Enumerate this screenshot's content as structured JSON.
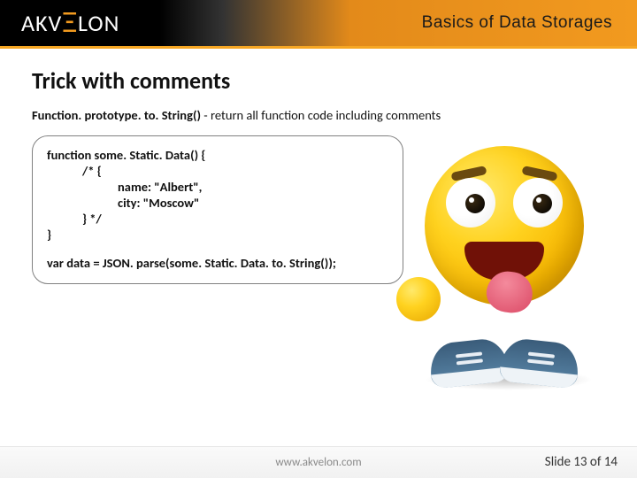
{
  "header": {
    "logo_left": "AKV",
    "logo_e": "Ξ",
    "logo_right": "LON",
    "title": "Basics of Data Storages"
  },
  "slide": {
    "title": "Trick with comments",
    "subtitle_func": "Function. prototype. to. String()",
    "subtitle_rest": "  -  return all function code including comments"
  },
  "code": {
    "l1": "function some. Static. Data() {",
    "l2": "/* {",
    "l3": "name: \"Albert\",",
    "l4": "city: \"Moscow\"",
    "l5": "} */",
    "l6": "}",
    "l7": "var data = JSON. parse(some. Static. Data. to. String());"
  },
  "footer": {
    "url": "www.akvelon.com",
    "page_label": "Slide 13 of 14"
  }
}
